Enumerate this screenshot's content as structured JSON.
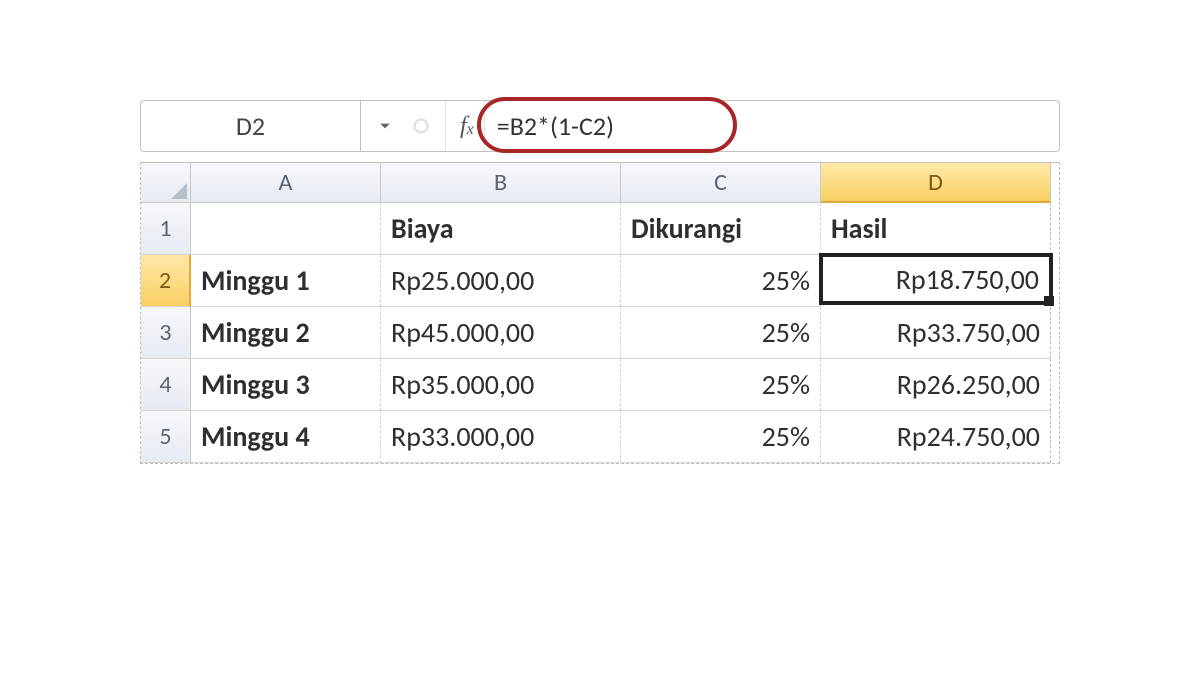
{
  "namebox": {
    "value": "D2"
  },
  "fx": {
    "prefix": "f",
    "sub": "x"
  },
  "formula": {
    "value": "=B2*(1-C2)"
  },
  "columns": [
    "A",
    "B",
    "C",
    "D"
  ],
  "rownums": [
    "1",
    "2",
    "3",
    "4",
    "5"
  ],
  "headers": {
    "A": "",
    "B": "Biaya",
    "C": "Dikurangi",
    "D": "Hasil"
  },
  "rows": [
    {
      "A": "Minggu 1",
      "B": "Rp25.000,00",
      "C": "25%",
      "D": "Rp18.750,00"
    },
    {
      "A": "Minggu 2",
      "B": "Rp45.000,00",
      "C": "25%",
      "D": "Rp33.750,00"
    },
    {
      "A": "Minggu 3",
      "B": "Rp35.000,00",
      "C": "25%",
      "D": "Rp26.250,00"
    },
    {
      "A": "Minggu 4",
      "B": "Rp33.000,00",
      "C": "25%",
      "D": "Rp24.750,00"
    }
  ],
  "selected": {
    "col": "D",
    "row": 2
  }
}
